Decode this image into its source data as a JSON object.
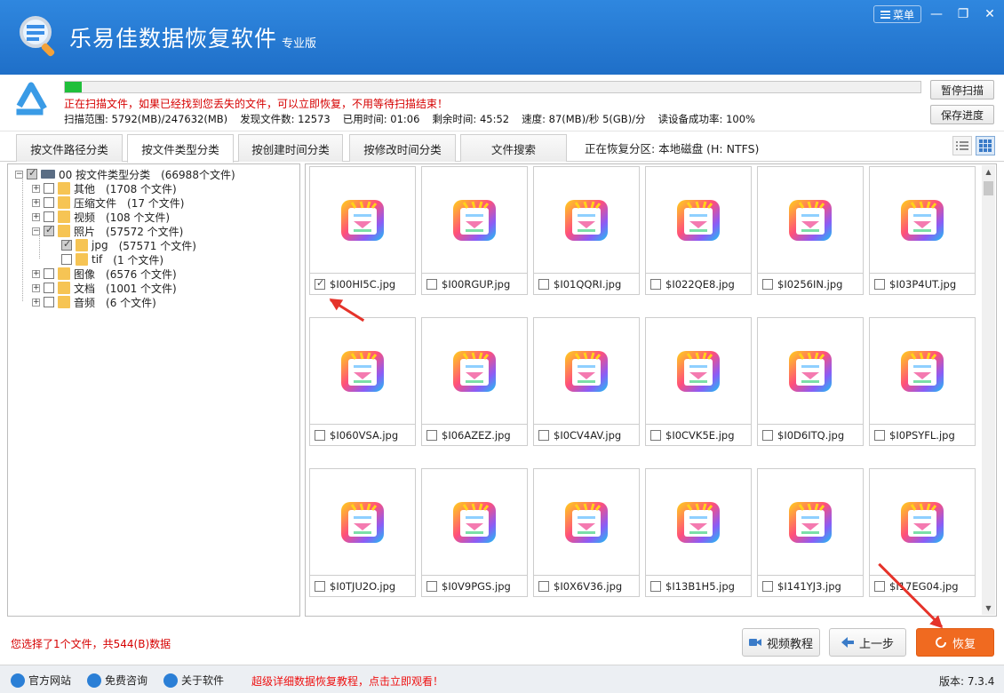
{
  "app": {
    "title": "乐易佳数据恢复软件",
    "edition": "专业版",
    "menu_label": "菜单"
  },
  "scan": {
    "progress_fraction": 0.02,
    "message": "正在扫描文件，如果已经找到您丢失的文件，可以立即恢复，不用等待扫描结束！",
    "stats": [
      "扫描范围: 5792(MB)/247632(MB)",
      "发现文件数: 12573",
      "已用时间: 01:06",
      "剩余时间: 45:52",
      "速度: 87(MB)/秒  5(GB)/分",
      "读设备成功率: 100%"
    ],
    "pause_label": "暂停扫描",
    "save_label": "保存进度"
  },
  "tabs": [
    {
      "label": "按文件路径分类",
      "active": false
    },
    {
      "label": "按文件类型分类",
      "active": true
    },
    {
      "label": "按创建时间分类",
      "active": false
    },
    {
      "label": "按修改时间分类",
      "active": false
    },
    {
      "label": "文件搜索",
      "active": false
    }
  ],
  "partition_label": "正在恢复分区: 本地磁盘 (H: NTFS)",
  "tree": {
    "root": {
      "label": "00  按文件类型分类",
      "count": "(66988个文件)"
    },
    "items": [
      {
        "label": "其他",
        "count": "(1708 个文件)",
        "level": 1,
        "expander": "+",
        "check": "none"
      },
      {
        "label": "压缩文件",
        "count": "(17 个文件)",
        "level": 1,
        "expander": "+",
        "check": "none"
      },
      {
        "label": "视频",
        "count": "(108 个文件)",
        "level": 1,
        "expander": "+",
        "check": "none"
      },
      {
        "label": "照片",
        "count": "(57572 个文件)",
        "level": 1,
        "expander": "−",
        "check": "partial"
      },
      {
        "label": "jpg",
        "count": "(57571 个文件)",
        "level": 2,
        "expander": "",
        "check": "partial"
      },
      {
        "label": "tif",
        "count": "(1 个文件)",
        "level": 2,
        "expander": "",
        "check": "none"
      },
      {
        "label": "图像",
        "count": "(6576 个文件)",
        "level": 1,
        "expander": "+",
        "check": "none"
      },
      {
        "label": "文档",
        "count": "(1001 个文件)",
        "level": 1,
        "expander": "+",
        "check": "none"
      },
      {
        "label": "音频",
        "count": "(6 个文件)",
        "level": 1,
        "expander": "+",
        "check": "none"
      }
    ]
  },
  "files": [
    {
      "name": "$I00HI5C.jpg",
      "checked": true
    },
    {
      "name": "$I00RGUP.jpg",
      "checked": false
    },
    {
      "name": "$I01QQRI.jpg",
      "checked": false
    },
    {
      "name": "$I022QE8.jpg",
      "checked": false
    },
    {
      "name": "$I0256IN.jpg",
      "checked": false
    },
    {
      "name": "$I03P4UT.jpg",
      "checked": false
    },
    {
      "name": "$I060VSA.jpg",
      "checked": false
    },
    {
      "name": "$I06AZEZ.jpg",
      "checked": false
    },
    {
      "name": "$I0CV4AV.jpg",
      "checked": false
    },
    {
      "name": "$I0CVK5E.jpg",
      "checked": false
    },
    {
      "name": "$I0D6ITQ.jpg",
      "checked": false
    },
    {
      "name": "$I0PSYFL.jpg",
      "checked": false
    },
    {
      "name": "$I0TJU2O.jpg",
      "checked": false
    },
    {
      "name": "$I0V9PGS.jpg",
      "checked": false
    },
    {
      "name": "$I0X6V36.jpg",
      "checked": false
    },
    {
      "name": "$I13B1H5.jpg",
      "checked": false
    },
    {
      "name": "$I141YJ3.jpg",
      "checked": false
    },
    {
      "name": "$I17EG04.jpg",
      "checked": false
    }
  ],
  "selection_info": "您选择了1个文件，共544(B)数据",
  "buttons": {
    "video_tutorial": "视频教程",
    "prev_step": "上一步",
    "recover": "恢复"
  },
  "footer": {
    "website": "官方网站",
    "consult": "免费咨询",
    "about": "关于软件",
    "promo": "超级详细数据恢复教程，点击立即观看！",
    "version": "版本: 7.3.4"
  },
  "colors": {
    "titlebar": "#1f6fc8",
    "progress": "#1fbf3a",
    "warning_text": "#d60000",
    "recover_button": "#f06a20",
    "annotation_arrow": "#e5332a"
  }
}
